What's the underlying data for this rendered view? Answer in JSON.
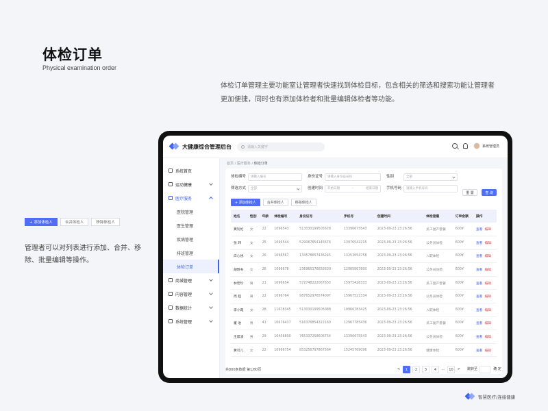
{
  "hero": {
    "title": "体检订单",
    "subtitle": "Physical examination order",
    "description": "体检订单管理主要功能室让管理者快速找到体检目标，包含相关的筛选和搜索功能让管理者更加便捷，同时也有添加体检者和批量编辑体检者等功能。"
  },
  "demo": {
    "add": "+ 添加体检人",
    "merge": "合并体检人",
    "remove": "移除体检人",
    "description": "管理者可以对列表进行添加、合并、移除、批量编辑等操作。"
  },
  "brand": "智慧医疗/连接健康",
  "app": {
    "title": "大健康综合管理后台",
    "search_placeholder": "请输入关键字",
    "user": "系统管理员"
  },
  "sidebar": {
    "items": [
      {
        "label": "系统首页",
        "icon": "home-icon"
      },
      {
        "label": "运动健康",
        "icon": "activity-icon"
      },
      {
        "label": "医疗服务",
        "icon": "medical-icon"
      }
    ],
    "sub": [
      "医院管理",
      "医生管理",
      "疾病管理",
      "排班管理",
      "体检订单"
    ],
    "items2": [
      {
        "label": "商城管理",
        "icon": "shop-icon"
      },
      {
        "label": "内容管理",
        "icon": "content-icon"
      },
      {
        "label": "数据统计",
        "icon": "stats-icon"
      },
      {
        "label": "系统管理",
        "icon": "settings-icon"
      }
    ]
  },
  "breadcrumb": {
    "a": "首页",
    "b": "医疗服务",
    "c": "体检订单",
    "sep": "/"
  },
  "filters": {
    "f1": {
      "label": "体检编号",
      "placeholder": "请输入编号"
    },
    "f2": {
      "label": "身份证号",
      "placeholder": "请输入身份证号码"
    },
    "f3": {
      "label": "性别",
      "placeholder": "全部"
    },
    "f4": {
      "label": "筛选方式",
      "placeholder": "全部"
    },
    "f5": {
      "label": "创建时间",
      "start": "开始日期",
      "sep": "-",
      "end": "结束日期"
    },
    "f6": {
      "label": "手机号码",
      "placeholder": "请输入手机号码"
    },
    "reset": "重 置",
    "query": "查 询"
  },
  "actions": {
    "add": "+ 添加体检人",
    "merge": "合并体检人",
    "remove": "移除体检人"
  },
  "table": {
    "headers": [
      "姓名",
      "性别",
      "年龄",
      "体检编号",
      "身份证号",
      "手机号",
      "创建时间",
      "体检套餐",
      "订单金额",
      "操作"
    ],
    "view": "查看",
    "edit": "编辑",
    "rows": [
      [
        "黄钊伦",
        "女",
        "22",
        "1096543",
        "513030199505678",
        "13390675543",
        "2023-09-23 23:26:56",
        "员工复产套餐",
        "600¥"
      ],
      [
        "张 玮",
        "女",
        "25",
        "1096544",
        "529087654145676",
        "13976542215",
        "2023-09-23 23:26:56",
        "公务员体检",
        "600¥"
      ],
      [
        "白心悦",
        "女",
        "26",
        "1096567",
        "134578657436245",
        "13253654758",
        "2023-09-23 23:26:56",
        "入职体检",
        "600¥"
      ],
      [
        "胡晓冬",
        "女",
        "26",
        "1096678",
        "236965376656630",
        "12985667800",
        "2023-09-23 23:26:56",
        "公务员体检",
        "600¥"
      ],
      [
        "林宏珍",
        "男",
        "21",
        "1096654",
        "572748222067653",
        "15975428333",
        "2023-09-23 23:26:56",
        "员工复产套餐",
        "600¥"
      ],
      [
        "周 超",
        "男",
        "22",
        "1096764",
        "987652976574097",
        "15967521334",
        "2023-09-23 23:26:56",
        "公务员体检",
        "600¥"
      ],
      [
        "李小霞",
        "女",
        "28",
        "11678345",
        "513030199505088",
        "10966783425",
        "2023-09-23 23:26:56",
        "入职体检",
        "600¥"
      ],
      [
        "董 进",
        "男",
        "41",
        "10676437",
        "516376854322160",
        "12967785436",
        "2023-09-23 23:26:56",
        "员工复产套餐",
        "600¥"
      ],
      [
        "王晨波",
        "男",
        "29",
        "10456890",
        "765337258606754",
        "13390675543",
        "2023-09-23 23:26:56",
        "公务员体检",
        "600¥"
      ],
      [
        "黄可儿",
        "女",
        "22",
        "10966754",
        "853256797867564",
        "15245769096",
        "2023-09-23 23:26:56",
        "健康体检",
        "600¥"
      ]
    ]
  },
  "pagination": {
    "total": "共800条数据 第1/80页",
    "pages": [
      "1",
      "2",
      "3",
      "4",
      "...",
      "10"
    ],
    "prev": "<",
    "next": ">",
    "goto": "跳转至",
    "confirm": "确 定"
  }
}
